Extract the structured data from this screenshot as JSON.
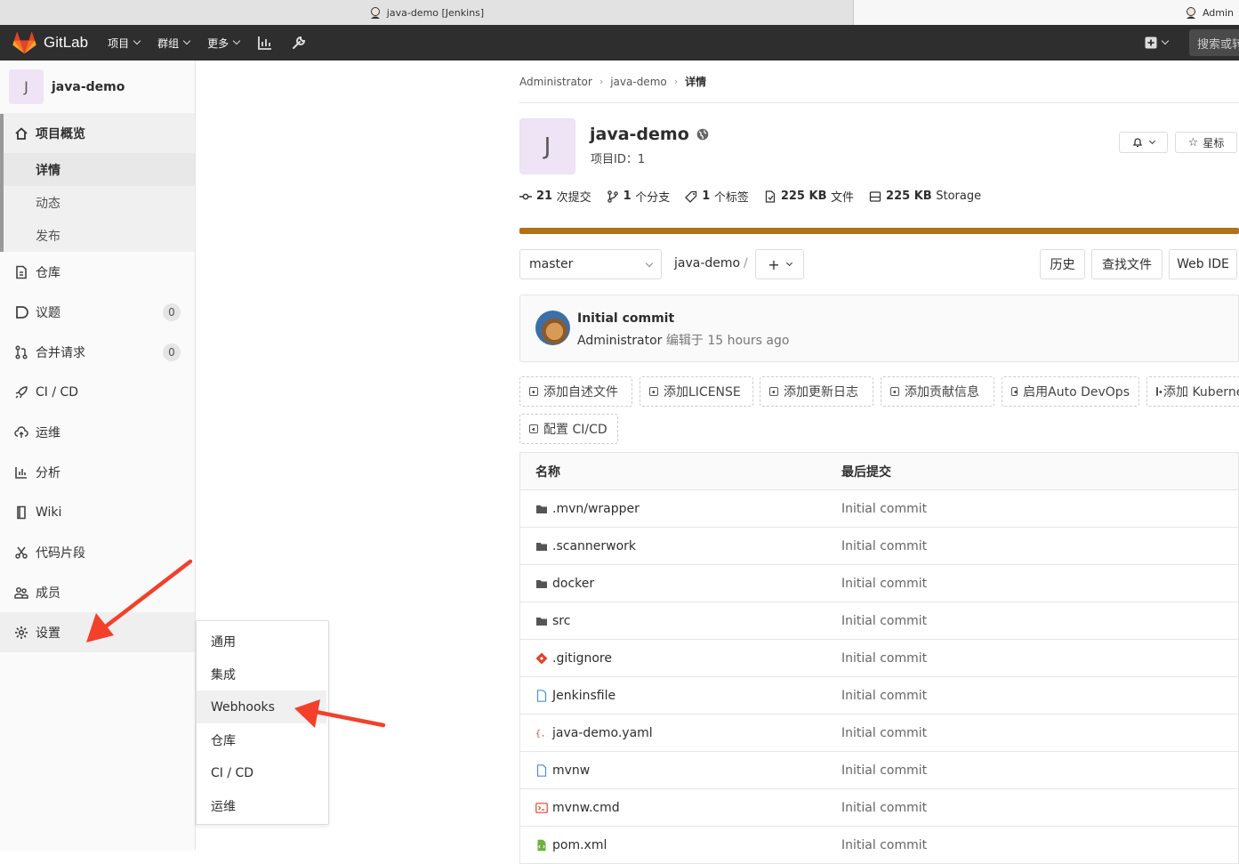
{
  "browser": {
    "tab1_title": "java-demo [Jenkins]",
    "tab2_title": "Admin"
  },
  "navbar": {
    "brand": "GitLab",
    "menu": [
      {
        "label": "项目"
      },
      {
        "label": "群组"
      },
      {
        "label": "更多"
      }
    ],
    "search_placeholder": "搜索或转"
  },
  "sidebar": {
    "project_avatar_letter": "J",
    "project_name": "java-demo",
    "overview_label": "项目概览",
    "overview_sub": [
      {
        "label": "详情"
      },
      {
        "label": "动态"
      },
      {
        "label": "发布"
      }
    ],
    "items": [
      {
        "label": "仓库",
        "icon": "doc-icon"
      },
      {
        "label": "议题",
        "icon": "issues-icon",
        "badge": "0"
      },
      {
        "label": "合并请求",
        "icon": "merge-request-icon",
        "badge": "0"
      },
      {
        "label": "CI / CD",
        "icon": "rocket-icon"
      },
      {
        "label": "运维",
        "icon": "cloud-icon"
      },
      {
        "label": "分析",
        "icon": "chart-icon"
      },
      {
        "label": "Wiki",
        "icon": "book-icon"
      },
      {
        "label": "代码片段",
        "icon": "scissors-icon"
      },
      {
        "label": "成员",
        "icon": "users-icon"
      },
      {
        "label": "设置",
        "icon": "gear-icon"
      }
    ]
  },
  "settings_flyout": [
    {
      "label": "通用"
    },
    {
      "label": "集成"
    },
    {
      "label": "Webhooks"
    },
    {
      "label": "仓库"
    },
    {
      "label": "CI / CD"
    },
    {
      "label": "运维"
    }
  ],
  "breadcrumb": {
    "items": [
      "Administrator",
      "java-demo"
    ],
    "current": "详情"
  },
  "project": {
    "avatar_letter": "J",
    "title": "java-demo",
    "id_text": "项目ID：1",
    "star_label": "星标",
    "stats": [
      {
        "value": "21",
        "label": "次提交"
      },
      {
        "value": "1",
        "label": "个分支"
      },
      {
        "value": "1",
        "label": "个标签"
      },
      {
        "value": "225 KB",
        "label": "文件"
      },
      {
        "value": "225 KB",
        "label": "Storage"
      }
    ],
    "language_color": "#b07219"
  },
  "tree": {
    "branch": "master",
    "path": "java-demo",
    "path_sep": "/",
    "add_label": "+",
    "buttons": [
      "历史",
      "查找文件",
      "Web IDE"
    ]
  },
  "last_commit": {
    "title": "Initial commit",
    "author": "Administrator",
    "meta": "编辑于 15 hours ago"
  },
  "quick_actions": [
    {
      "label": "添加自述文件"
    },
    {
      "label": "添加LICENSE"
    },
    {
      "label": "添加更新日志"
    },
    {
      "label": "添加贡献信息"
    },
    {
      "label": "启用Auto DevOps"
    },
    {
      "label": "添加 Kubernetes"
    },
    {
      "label": "配置 CI/CD"
    }
  ],
  "files": {
    "headers": [
      "名称",
      "最后提交"
    ],
    "rows": [
      {
        "name": ".mvn/wrapper",
        "type": "folder",
        "commit": "Initial commit"
      },
      {
        "name": ".scannerwork",
        "type": "folder",
        "commit": "Initial commit"
      },
      {
        "name": "docker",
        "type": "folder",
        "commit": "Initial commit"
      },
      {
        "name": "src",
        "type": "folder",
        "commit": "Initial commit"
      },
      {
        "name": ".gitignore",
        "type": "git",
        "commit": "Initial commit"
      },
      {
        "name": "Jenkinsfile",
        "type": "file",
        "commit": "Initial commit"
      },
      {
        "name": "java-demo.yaml",
        "type": "yaml",
        "commit": "Initial commit"
      },
      {
        "name": "mvnw",
        "type": "file",
        "commit": "Initial commit"
      },
      {
        "name": "mvnw.cmd",
        "type": "terminal",
        "commit": "Initial commit"
      },
      {
        "name": "pom.xml",
        "type": "xml",
        "commit": "Initial commit"
      }
    ]
  },
  "colors": {
    "navbar": "#2e2e2e",
    "arrow": "#f2402b",
    "gitlab_orange": "#fc6d26"
  }
}
